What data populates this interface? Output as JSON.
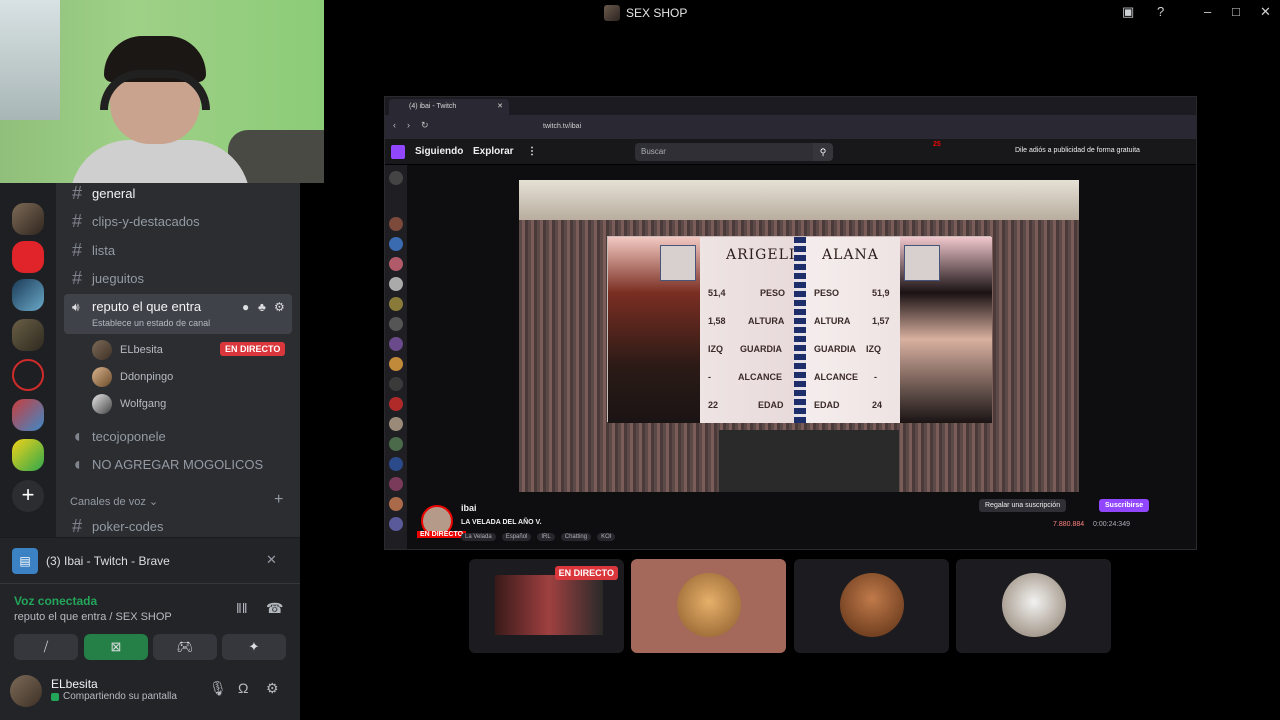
{
  "window": {
    "title": "SEX SHOP"
  },
  "channels": {
    "text": [
      "general",
      "clips-y-destacados",
      "lista",
      "jueguitos"
    ],
    "voice_active": {
      "name": "reputo el que entra",
      "status_hint": "Establece un estado de canal",
      "users": [
        {
          "name": "ELbesita",
          "live": "EN DIRECTO"
        },
        {
          "name": "Ddonpingo"
        },
        {
          "name": "Wolfgang"
        }
      ]
    },
    "voice_other": [
      "tecojoponele",
      "NO AGREGAR MOGOLICOS"
    ],
    "category": "Canales de voz",
    "after_category": [
      "poker-codes"
    ]
  },
  "stream_card": {
    "label": "(3) Ibai - Twitch - Brave"
  },
  "voice_panel": {
    "status": "Voz conectada",
    "location": "reputo el que entra / SEX SHOP"
  },
  "user": {
    "name": "ELbesita",
    "status": "Compartiendo su pantalla"
  },
  "browser": {
    "tab_title": "(4) ibai - Twitch",
    "url": "twitch.tv/ibai",
    "nav": {
      "following": "Siguiendo",
      "explore": "Explorar"
    },
    "search_placeholder": "Buscar",
    "promo": "Dile adiós a publicidad de forma gratuita",
    "notif_count": "25"
  },
  "graphic": {
    "left": {
      "name": "ARIGELI",
      "rows": [
        [
          "51,4",
          "PESO"
        ],
        [
          "1,58",
          "ALTURA"
        ],
        [
          "IZQ",
          "GUARDIA"
        ],
        [
          "-",
          "ALCANCE"
        ],
        [
          "22",
          "EDAD"
        ]
      ]
    },
    "right": {
      "name": "ALANA",
      "rows": [
        [
          "PESO",
          "51,9"
        ],
        [
          "ALTURA",
          "1,57"
        ],
        [
          "GUARDIA",
          "IZQ"
        ],
        [
          "ALCANCE",
          "-"
        ],
        [
          "EDAD",
          "24"
        ]
      ]
    }
  },
  "stream_info": {
    "streamer": "ibai",
    "title": "LA VELADA DEL AÑO V.",
    "live": "EN DIRECTO",
    "tags": [
      "La Velada",
      "Español",
      "IRL",
      "Chatting",
      "KOI"
    ],
    "gift": "Regalar una suscripción",
    "subscribe": "Suscribirse",
    "viewers": "7.880.884",
    "uptime": "0:00:24:349"
  },
  "tiles": {
    "live_label": "EN DIRECTO"
  },
  "colors": {
    "discord_bg": "#2b2d31",
    "twitch_purple": "#9146ff",
    "live_red": "#da373c",
    "voice_green": "#23a55a"
  }
}
